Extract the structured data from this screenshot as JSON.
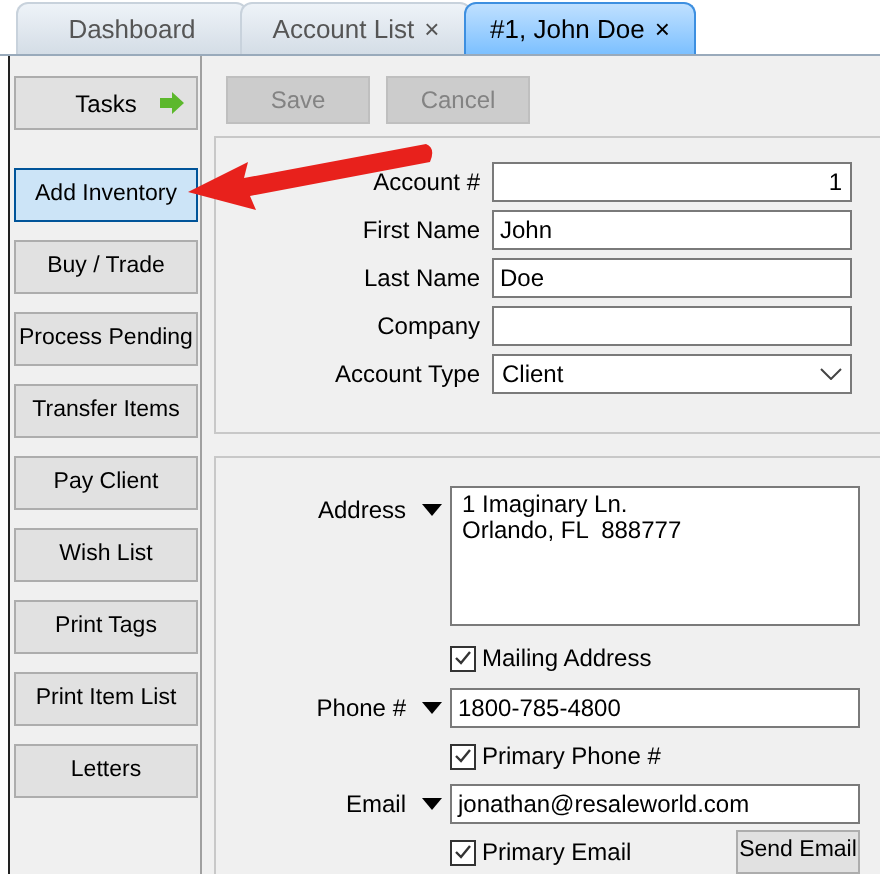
{
  "tabs": [
    {
      "label": "Dashboard",
      "selected": false
    },
    {
      "label": "Account List",
      "selected": false,
      "close": "×"
    },
    {
      "label": "#1, John Doe",
      "selected": true,
      "close": "×"
    }
  ],
  "sidebar": {
    "tasks": {
      "label": "Tasks"
    },
    "items": [
      {
        "label": "Add Inventory",
        "selected": true
      },
      {
        "label": "Buy / Trade",
        "selected": false
      },
      {
        "label": "Process Pending",
        "selected": false
      },
      {
        "label": "Transfer Items",
        "selected": false
      },
      {
        "label": "Pay Client",
        "selected": false
      },
      {
        "label": "Wish List",
        "selected": false
      },
      {
        "label": "Print Tags",
        "selected": false
      },
      {
        "label": "Print Item List",
        "selected": false
      },
      {
        "label": "Letters",
        "selected": false
      }
    ]
  },
  "toolbar": [
    {
      "label": "Save",
      "disabled": true
    },
    {
      "label": "Cancel",
      "disabled": true
    }
  ],
  "account_fields": [
    {
      "label": "Account #",
      "value": "1",
      "kind": "number"
    },
    {
      "label": "First Name",
      "value": "John",
      "kind": "text"
    },
    {
      "label": "Last Name",
      "value": "Doe",
      "kind": "text"
    },
    {
      "label": "Company",
      "kind": "text"
    },
    {
      "label": "Account Type",
      "value": "Client",
      "kind": "select"
    }
  ],
  "contact": {
    "address": {
      "label": "Address",
      "value": "1 Imaginary Ln.\nOrlando, FL  888777",
      "option": {
        "label": "Mailing Address",
        "checked": true
      }
    },
    "phone": {
      "label": "Phone #",
      "value": "1800-785-4800",
      "option": {
        "label": "Primary Phone #",
        "checked": true
      }
    },
    "email": {
      "label": "Email",
      "value": "jonathan@resaleworld.com",
      "option": {
        "label": "Primary Email",
        "checked": true
      },
      "button": "Send Email"
    }
  }
}
